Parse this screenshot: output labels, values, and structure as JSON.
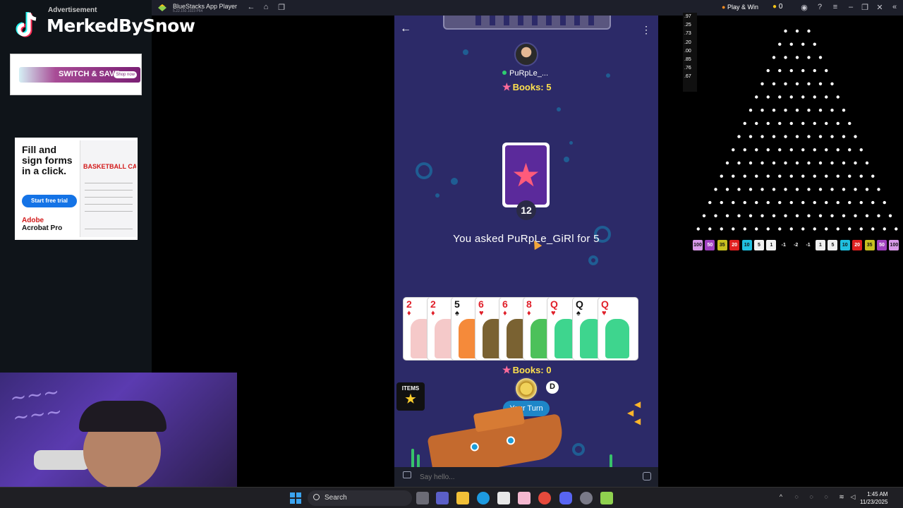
{
  "stream_overlay": {
    "handle": "MerkedBySnow",
    "advertisement_label": "Advertisement",
    "ad1": {
      "headline": "SWITCH & SAVE",
      "cta": "Shop now"
    },
    "ad2": {
      "headline": "Fill and sign forms in a click.",
      "cta": "Start free trial",
      "brand_line1": "Adobe",
      "brand_line2": "Acrobat Pro",
      "doc_title": "BASKETBALL CA"
    }
  },
  "emulator": {
    "title": "BlueStacks App Player",
    "version": "5.22.150.1023 P64",
    "play_win": "Play & Win",
    "coins": "0"
  },
  "game": {
    "opponent": {
      "name": "PuRpLe_...",
      "books_label": "Books: 5"
    },
    "deck": {
      "remaining": "12"
    },
    "status_message": "You asked PuRpLe_GiRl for 5",
    "hand": [
      {
        "rank": "2",
        "suit": "♦",
        "color": "red",
        "art": "#f5c9c9"
      },
      {
        "rank": "2",
        "suit": "♦",
        "color": "red",
        "art": "#f5c9c9"
      },
      {
        "rank": "5",
        "suit": "♠",
        "color": "blk",
        "art": "#f58a3a"
      },
      {
        "rank": "6",
        "suit": "♥",
        "color": "red",
        "art": "#7a6232"
      },
      {
        "rank": "6",
        "suit": "♦",
        "color": "red",
        "art": "#7a6232"
      },
      {
        "rank": "8",
        "suit": "♦",
        "color": "red",
        "art": "#4cc15a"
      },
      {
        "rank": "Q",
        "suit": "♥",
        "color": "red",
        "art": "#3ed58e"
      },
      {
        "rank": "Q",
        "suit": "♠",
        "color": "blk",
        "art": "#3ed58e"
      },
      {
        "rank": "Q",
        "suit": "♥",
        "color": "red",
        "art": "#3ed58e"
      }
    ],
    "player": {
      "books_label": "Books: 0",
      "dealer_badge": "D",
      "turn_label": "Your Turn",
      "timer_fraction": 0.7
    },
    "items_label": "ITEMS",
    "chat_placeholder": "Say hello..."
  },
  "plinko": {
    "multiplier_list": [
      ".97",
      ".25",
      ".73",
      ".20",
      ".00",
      ".85",
      ".76",
      ".67"
    ],
    "slots": [
      {
        "label": "100",
        "color": "#d89ae8"
      },
      {
        "label": "50",
        "color": "#a040c0"
      },
      {
        "label": "35",
        "color": "#c8c020"
      },
      {
        "label": "20",
        "color": "#e02020"
      },
      {
        "label": "10",
        "color": "#20c0e0"
      },
      {
        "label": "5",
        "color": "#f0f0f0"
      },
      {
        "label": "1",
        "color": "#f0f0f0"
      },
      {
        "label": "-1",
        "color": "#000000"
      },
      {
        "label": "-2",
        "color": "#000000"
      },
      {
        "label": "-1",
        "color": "#000000"
      },
      {
        "label": "1",
        "color": "#f0f0f0"
      },
      {
        "label": "5",
        "color": "#f0f0f0"
      },
      {
        "label": "10",
        "color": "#20c0e0"
      },
      {
        "label": "20",
        "color": "#e02020"
      },
      {
        "label": "35",
        "color": "#c8c020"
      },
      {
        "label": "50",
        "color": "#a040c0"
      },
      {
        "label": "100",
        "color": "#d89ae8"
      }
    ]
  },
  "taskbar": {
    "search_label": "Search",
    "time": "1:45 AM",
    "date": "11/23/2025"
  }
}
